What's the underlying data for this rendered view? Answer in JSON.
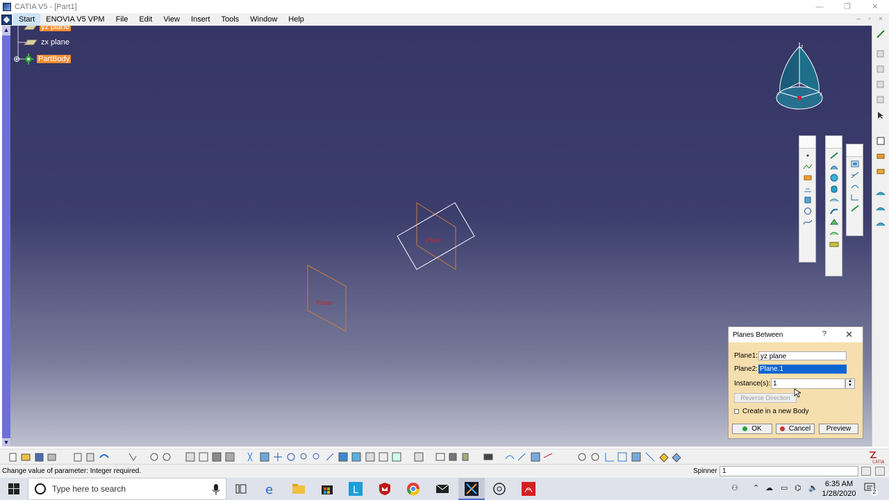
{
  "window": {
    "title": "CATIA V5 - [Part1]",
    "minimize": "—",
    "restore": "❐",
    "close": "✕"
  },
  "menu": {
    "items": [
      "Start",
      "ENOVIA V5 VPM",
      "File",
      "Edit",
      "View",
      "Insert",
      "Tools",
      "Window",
      "Help"
    ],
    "right": [
      "–",
      "▫",
      "×"
    ]
  },
  "tree": {
    "items": [
      {
        "label": "yz plane",
        "selected": true
      },
      {
        "label": "zx plane",
        "selected": false
      },
      {
        "label": "PartBody",
        "selected": true
      }
    ]
  },
  "scene": {
    "plane_labels": [
      "Plane",
      "Plane"
    ],
    "compass_letters": [
      "z",
      "x",
      "y"
    ]
  },
  "dialog": {
    "title": "Planes Between",
    "help": "?",
    "close": "✕",
    "plane1_label": "Plane1:",
    "plane1_value": "yz plane",
    "plane2_label": "Plane2:",
    "plane2_value": "Plane.1",
    "instances_label": "Instance(s):",
    "instances_value": "1",
    "reverse_label": "Reverse Direction",
    "new_body_label": "Create in a new Body",
    "new_body_checked": false,
    "ok_label": "OK",
    "cancel_label": "Cancel",
    "preview_label": "Preview"
  },
  "status": {
    "message": "Change value of parameter: Integer required.",
    "spinner_label": "Spinner",
    "spinner_value": "1"
  },
  "taskbar": {
    "search_placeholder": "Type here to search",
    "time": "6:35 AM",
    "date": "1/28/2020",
    "notifications": "2"
  },
  "colors": {
    "viewport_top": "#353665",
    "viewport_bottom": "#bfc0cf",
    "selection_orange": "#f38e36",
    "dialog_bg": "#f6dfae",
    "plane_edge_orange": "#c97a3e",
    "plane_edge_white": "#ffffff",
    "plane_label_red": "#c1282d",
    "field_highlight": "#0a64d2"
  }
}
